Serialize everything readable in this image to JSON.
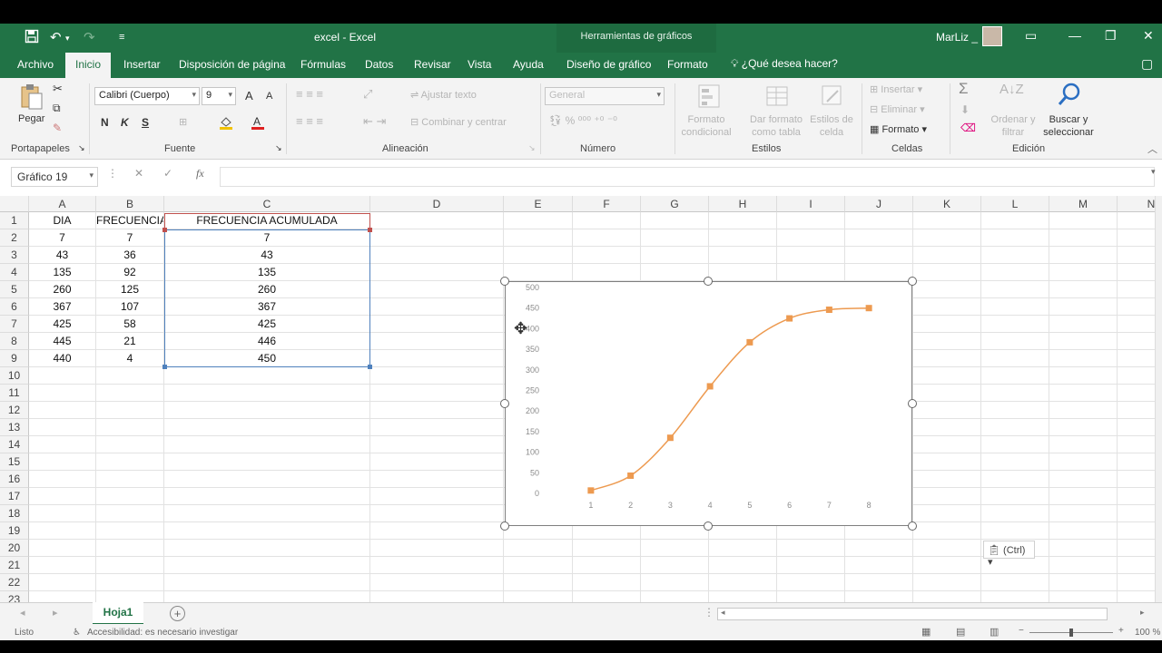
{
  "window": {
    "title": "excel  -  Excel",
    "context_title": "Herramientas de gráficos",
    "user": "MarLiz _"
  },
  "tabs": [
    {
      "label": "Archivo"
    },
    {
      "label": "Inicio"
    },
    {
      "label": "Insertar"
    },
    {
      "label": "Disposición de página"
    },
    {
      "label": "Fórmulas"
    },
    {
      "label": "Datos"
    },
    {
      "label": "Revisar"
    },
    {
      "label": "Vista"
    },
    {
      "label": "Ayuda"
    },
    {
      "label": "Diseño de gráfico"
    },
    {
      "label": "Formato"
    }
  ],
  "tell_me": "¿Qué desea hacer?",
  "ribbon": {
    "clipboard": {
      "paste": "Pegar",
      "label": "Portapapeles"
    },
    "font": {
      "family": "Calibri (Cuerpo)",
      "size": "9",
      "bold": "N",
      "italic": "K",
      "underline": "S",
      "grow": "A",
      "shrink": "A",
      "label": "Fuente"
    },
    "alignment": {
      "wrap": "Ajustar texto",
      "merge": "Combinar y centrar",
      "label": "Alineación"
    },
    "number": {
      "format": "General",
      "label": "Número"
    },
    "styles": {
      "cond_format": "Formato condicional",
      "table_format": "Dar formato como tabla",
      "cell_styles": "Estilos de celda",
      "label": "Estilos"
    },
    "cells": {
      "insert": "Insertar",
      "delete": "Eliminar",
      "format": "Formato",
      "label": "Celdas"
    },
    "editing": {
      "sort": "Ordenar y filtrar",
      "find": "Buscar y seleccionar",
      "label": "Edición"
    }
  },
  "formula_bar": {
    "name_box": "Gráfico 19",
    "fx": "fx",
    "formula": ""
  },
  "sheet": {
    "columns": [
      "A",
      "B",
      "C",
      "D",
      "E",
      "F",
      "G",
      "H",
      "I",
      "J",
      "K",
      "L",
      "M",
      "N"
    ],
    "rows": [
      "1",
      "2",
      "3",
      "4",
      "5",
      "6",
      "7",
      "8",
      "9",
      "10",
      "11",
      "12",
      "13",
      "14",
      "15",
      "16",
      "17",
      "18",
      "19",
      "20",
      "21",
      "22",
      "23"
    ],
    "headers": [
      "DIA",
      "FRECUENCIA",
      "FRECUENCIA ACUMULADA"
    ],
    "data": [
      [
        "7",
        "7",
        "7"
      ],
      [
        "43",
        "36",
        "43"
      ],
      [
        "135",
        "92",
        "135"
      ],
      [
        "260",
        "125",
        "260"
      ],
      [
        "367",
        "107",
        "367"
      ],
      [
        "425",
        "58",
        "425"
      ],
      [
        "445",
        "21",
        "446"
      ],
      [
        "440",
        "4",
        "450"
      ]
    ]
  },
  "chart_data": {
    "type": "line",
    "categories": [
      "1",
      "2",
      "3",
      "4",
      "5",
      "6",
      "7",
      "8"
    ],
    "series": [
      {
        "values": [
          7,
          43,
          135,
          260,
          367,
          425,
          446,
          450
        ]
      }
    ],
    "ylim": [
      0,
      500
    ],
    "yticks": [
      "0",
      "50",
      "100",
      "150",
      "200",
      "250",
      "300",
      "350",
      "400",
      "450",
      "500"
    ],
    "line_color": "#ed9a50",
    "grid": false,
    "title": "",
    "xlabel": "",
    "ylabel": ""
  },
  "paste_options": "(Ctrl)",
  "sheet_tabs": [
    {
      "label": "Hoja1"
    }
  ],
  "status": {
    "ready": "Listo",
    "accessibility": "Accesibilidad: es necesario investigar",
    "zoom": "100 %"
  },
  "colors": {
    "brand": "#217346",
    "selection": "#4f81bd",
    "header_select": "#c0504d"
  }
}
